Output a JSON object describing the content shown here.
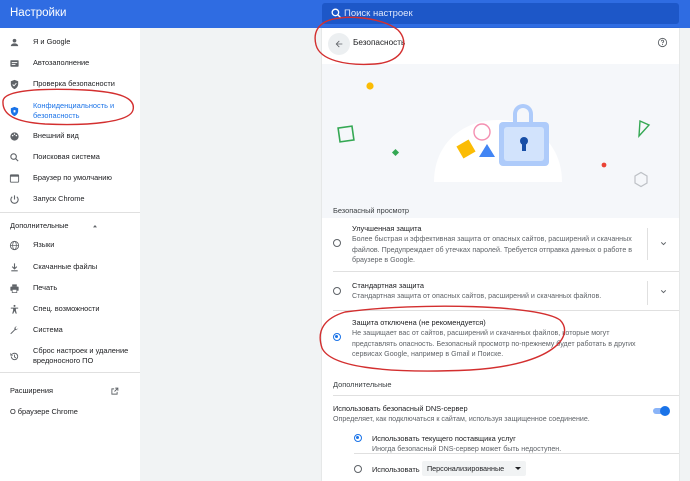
{
  "app": {
    "title": "Настройки"
  },
  "search": {
    "placeholder": "Поиск настроек",
    "icon": "search-icon"
  },
  "sidebar": {
    "items": [
      {
        "label": "Я и Google",
        "icon": "person-icon"
      },
      {
        "label": "Автозаполнение",
        "icon": "autofill-icon"
      },
      {
        "label": "Проверка безопасности",
        "icon": "shield-check-icon"
      },
      {
        "label": "Конфиденциальность и безопасность",
        "icon": "shield-icon",
        "active": true
      },
      {
        "label": "Внешний вид",
        "icon": "palette-icon"
      },
      {
        "label": "Поисковая система",
        "icon": "search-icon"
      },
      {
        "label": "Браузер по умолчанию",
        "icon": "browser-icon"
      },
      {
        "label": "Запуск Chrome",
        "icon": "power-icon"
      }
    ],
    "advanced_header": "Дополнительные",
    "advanced_items": [
      {
        "label": "Языки",
        "icon": "globe-icon"
      },
      {
        "label": "Скачанные файлы",
        "icon": "download-icon"
      },
      {
        "label": "Печать",
        "icon": "printer-icon"
      },
      {
        "label": "Спец. возможности",
        "icon": "accessibility-icon"
      },
      {
        "label": "Система",
        "icon": "wrench-icon"
      },
      {
        "label": "Сброс настроек и удаление вредоносного ПО",
        "icon": "restore-icon"
      }
    ],
    "extensions": "Расширения",
    "about": "О браузере Chrome"
  },
  "main": {
    "title": "Безопасность",
    "section_title": "Безопасный просмотр",
    "options": [
      {
        "title": "Улучшенная защита",
        "desc": "Более быстрая и эффективная защита от опасных сайтов, расширений и скачанных файлов. Предупреждает об утечках паролей. Требуется отправка данных о работе в браузере в Google.",
        "selected": false
      },
      {
        "title": "Стандартная защита",
        "desc": "Стандартная защита от опасных сайтов, расширений и скачанных файлов.",
        "selected": false
      },
      {
        "title": "Защита отключена (не рекомендуется)",
        "desc": "Не защищает вас от сайтов, расширений и скачанных файлов, которые могут представлять опасность. Безопасный просмотр по-прежнему будет работать в других сервисах Google, например в Gmail и Поиске.",
        "selected": true
      }
    ],
    "more_title": "Дополнительные",
    "dns": {
      "title": "Использовать безопасный DNS-сервер",
      "desc": "Определяет, как подключаться к сайтам, используя защищенное соединение.",
      "enabled": true,
      "current_title": "Использовать текущего поставщика услуг",
      "current_desc": "Иногда безопасный DNS-сервер может быть недоступен.",
      "use_label": "Использовать",
      "provider": "Персонализированные"
    }
  },
  "colors": {
    "topbar": "#2f6ce2",
    "accent": "#1a73e8",
    "annotation": "#d32f2f"
  }
}
